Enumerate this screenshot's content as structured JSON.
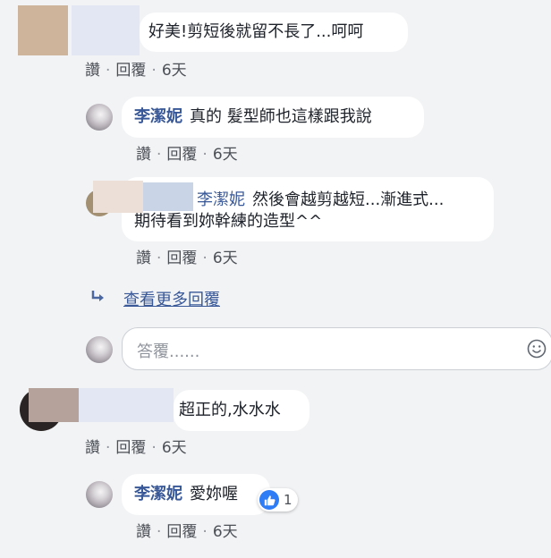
{
  "comment1": {
    "text": "好美!剪短後就留不長了...呵呵",
    "actions": {
      "like": "讚",
      "reply": "回覆",
      "time": "6天"
    }
  },
  "reply1": {
    "author": "李潔妮",
    "text": "真的 髮型師也這樣跟我說",
    "actions": {
      "like": "讚",
      "reply": "回覆",
      "time": "6天"
    }
  },
  "reply2": {
    "author": "李潔妮",
    "line1": "然後會越剪越短...漸進式...",
    "line2": "期待看到妳幹練的造型^^",
    "actions": {
      "like": "讚",
      "reply": "回覆",
      "time": "6天"
    }
  },
  "view_more": {
    "label": "查看更多回覆"
  },
  "reply_input": {
    "placeholder": "答覆......"
  },
  "comment2": {
    "text": "超正的,水水水",
    "actions": {
      "like": "讚",
      "reply": "回覆",
      "time": "6天"
    }
  },
  "reply3": {
    "author": "李潔妮",
    "text": "愛妳喔",
    "like_count": "1",
    "actions": {
      "like": "讚",
      "reply": "回覆",
      "time": "6天"
    }
  },
  "colors": {
    "background": "#f2f3f5",
    "name": "#385898",
    "like_blue": "#2e7cf6"
  }
}
